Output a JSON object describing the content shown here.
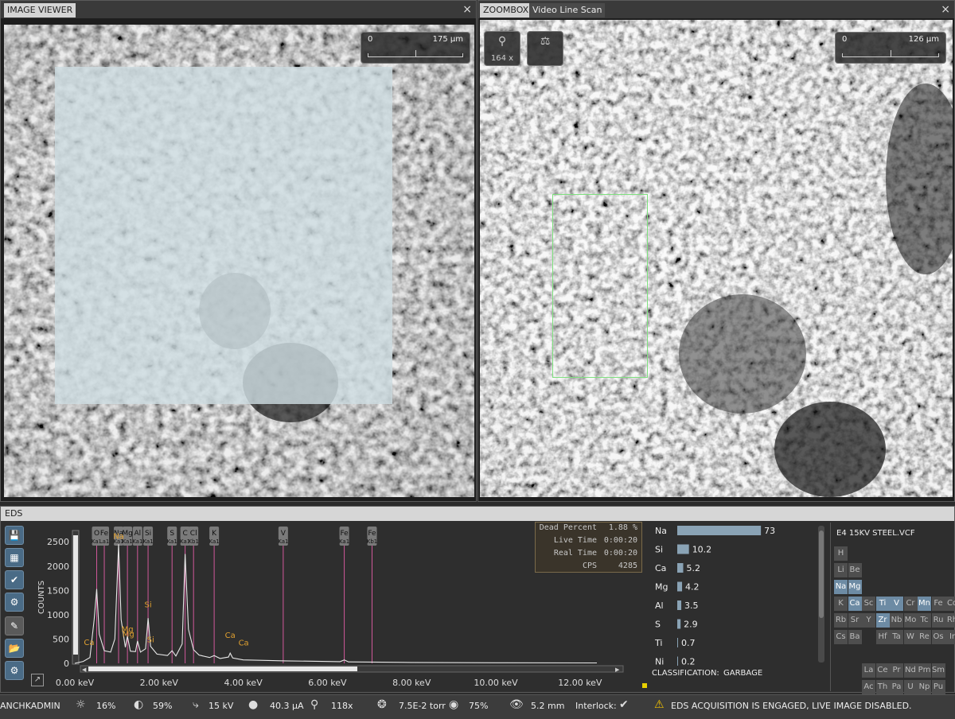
{
  "viewer": {
    "title": "IMAGE VIEWER",
    "close": "×",
    "scale_left": "0",
    "scale_right": "175 µm"
  },
  "zoombox": {
    "tabs": [
      "ZOOMBOX",
      "Video Line Scan"
    ],
    "close": "×",
    "zoom_label": "164 x",
    "zoom_icon": "search-icon",
    "flask_icon": "flask-icon",
    "scale_left": "0",
    "scale_right": "126 µm"
  },
  "eds": {
    "title": "EDS",
    "tools": [
      "save-icon",
      "table-icon",
      "check-icon",
      "gear-icon",
      "pencil-icon",
      "folder-icon",
      "gears-icon"
    ],
    "stats": {
      "rows": [
        {
          "label": "Dead Percent",
          "value": "1.88 %"
        },
        {
          "label": "Live Time",
          "value": "0:00:20"
        },
        {
          "label": "Real Time",
          "value": "0:00:20"
        },
        {
          "label": "CPS",
          "value": "4285"
        }
      ]
    },
    "classification_label": "CLASSIFICATION:",
    "classification_value": "GARBAGE",
    "vcf_name": "E4 15KV STEEL.VCF"
  },
  "chart_data": {
    "type": "line",
    "ylabel": "COUNTS",
    "ylim": [
      0,
      2700
    ],
    "xlim": [
      0,
      12.4
    ],
    "yticks": [
      "0",
      "500",
      "1000",
      "1500",
      "2000",
      "2500"
    ],
    "xticks": [
      "0.00 keV",
      "2.00 keV",
      "4.00 keV",
      "6.00 keV",
      "8.00 keV",
      "10.00 keV",
      "12.00 keV"
    ],
    "peak_markers": [
      {
        "name": "O",
        "line": "Ka1",
        "energy": 0.52
      },
      {
        "name": "Fe",
        "line": "La1",
        "energy": 0.7
      },
      {
        "name": "Na",
        "line": "Ka1",
        "energy": 1.04
      },
      {
        "name": "Mg",
        "line": "Ka1",
        "energy": 1.25
      },
      {
        "name": "Al",
        "line": "Ka1",
        "energy": 1.49
      },
      {
        "name": "Si",
        "line": "Ka1",
        "energy": 1.74
      },
      {
        "name": "S",
        "line": "Ka1",
        "energy": 2.31
      },
      {
        "name": "C",
        "line": "Ka1",
        "energy": 2.62
      },
      {
        "name": "Cl",
        "line": "Kb1",
        "energy": 2.82
      },
      {
        "name": "K",
        "line": "Ka1",
        "energy": 3.31
      },
      {
        "name": "V",
        "line": "Ka1",
        "energy": 4.95
      },
      {
        "name": "Fe",
        "line": "Ka1",
        "energy": 6.4
      },
      {
        "name": "Fe",
        "line": "Kb1",
        "energy": 7.06
      }
    ],
    "peak_labels": [
      {
        "text": "Ca",
        "energy": 0.34,
        "counts": 380
      },
      {
        "text": "Na",
        "energy": 1.04,
        "counts": 2560
      },
      {
        "text": "Mg",
        "energy": 1.25,
        "counts": 650
      },
      {
        "text": "Mg",
        "energy": 1.27,
        "counts": 550
      },
      {
        "text": "Si",
        "energy": 1.74,
        "counts": 1150
      },
      {
        "text": "Si",
        "energy": 1.8,
        "counts": 430
      },
      {
        "text": "Ca",
        "energy": 3.69,
        "counts": 520
      },
      {
        "text": "Ca",
        "energy": 4.01,
        "counts": 370
      }
    ],
    "spectrum": [
      [
        0.0,
        0
      ],
      [
        0.2,
        40
      ],
      [
        0.36,
        120
      ],
      [
        0.46,
        900
      ],
      [
        0.52,
        1530
      ],
      [
        0.58,
        600
      ],
      [
        0.7,
        260
      ],
      [
        0.85,
        230
      ],
      [
        0.95,
        500
      ],
      [
        1.04,
        2450
      ],
      [
        1.1,
        900
      ],
      [
        1.2,
        330
      ],
      [
        1.25,
        560
      ],
      [
        1.32,
        250
      ],
      [
        1.44,
        240
      ],
      [
        1.49,
        460
      ],
      [
        1.56,
        230
      ],
      [
        1.68,
        300
      ],
      [
        1.74,
        930
      ],
      [
        1.8,
        350
      ],
      [
        1.95,
        190
      ],
      [
        2.2,
        160
      ],
      [
        2.31,
        260
      ],
      [
        2.4,
        150
      ],
      [
        2.55,
        400
      ],
      [
        2.62,
        2250
      ],
      [
        2.7,
        700
      ],
      [
        2.82,
        280
      ],
      [
        2.95,
        170
      ],
      [
        3.2,
        120
      ],
      [
        3.31,
        160
      ],
      [
        3.45,
        100
      ],
      [
        3.65,
        130
      ],
      [
        3.69,
        210
      ],
      [
        3.75,
        110
      ],
      [
        4.0,
        70
      ],
      [
        5.0,
        50
      ],
      [
        6.3,
        35
      ],
      [
        6.4,
        70
      ],
      [
        6.5,
        30
      ],
      [
        8.0,
        18
      ],
      [
        10.0,
        12
      ],
      [
        12.4,
        8
      ]
    ]
  },
  "quant_data": {
    "type": "bar",
    "categories": [
      "Na",
      "Si",
      "Ca",
      "Mg",
      "Al",
      "S",
      "Ti",
      "Ni"
    ],
    "values": [
      73,
      10.2,
      5.2,
      4.2,
      3.5,
      2.9,
      0.7,
      0.2
    ],
    "value_labels": [
      "73",
      "10.2",
      "5.2",
      "4.2",
      "3.5",
      "2.9",
      "0.7",
      "0.2"
    ],
    "xlim": [
      0,
      75
    ]
  },
  "periodic_table": {
    "rows": [
      [
        {
          "s": "H"
        }
      ],
      [
        {
          "s": "Li"
        },
        {
          "s": "Be"
        }
      ],
      [
        {
          "s": "Na",
          "on": true
        },
        {
          "s": "Mg",
          "on": true
        }
      ],
      [
        {
          "s": "K"
        },
        {
          "s": "Ca",
          "on": true
        },
        {
          "s": "Sc"
        },
        {
          "s": "Ti",
          "on": true
        },
        {
          "s": "V",
          "on": true
        },
        {
          "s": "Cr"
        },
        {
          "s": "Mn",
          "on": true
        },
        {
          "s": "Fe"
        },
        {
          "s": "Co"
        }
      ],
      [
        {
          "s": "Rb"
        },
        {
          "s": "Sr"
        },
        {
          "s": "Y"
        },
        {
          "s": "Zr",
          "on": true
        },
        {
          "s": "Nb"
        },
        {
          "s": "Mo"
        },
        {
          "s": "Tc"
        },
        {
          "s": "Ru"
        },
        {
          "s": "Rh"
        }
      ],
      [
        {
          "s": "Cs"
        },
        {
          "s": "Ba"
        },
        {
          "s": ""
        },
        {
          "s": "Hf"
        },
        {
          "s": "Ta"
        },
        {
          "s": "W"
        },
        {
          "s": "Re"
        },
        {
          "s": "Os"
        },
        {
          "s": "Ir"
        }
      ],
      [
        {
          "s": ""
        }
      ],
      [
        {
          "s": ""
        },
        {
          "s": ""
        },
        {
          "s": "La"
        },
        {
          "s": "Ce"
        },
        {
          "s": "Pr"
        },
        {
          "s": "Nd"
        },
        {
          "s": "Pm"
        },
        {
          "s": "Sm"
        }
      ],
      [
        {
          "s": ""
        },
        {
          "s": ""
        },
        {
          "s": "Ac"
        },
        {
          "s": "Th"
        },
        {
          "s": "Pa"
        },
        {
          "s": "U"
        },
        {
          "s": "Np"
        },
        {
          "s": "Pu"
        }
      ]
    ]
  },
  "status": {
    "user": "ANCHKADMIN",
    "brightness": "16%",
    "contrast": "59%",
    "voltage": "15 kV",
    "current": "40.3 µA",
    "magnification": "118x",
    "pressure": "7.5E-2 torr",
    "spot": "75%",
    "working_distance": "5.2 mm",
    "interlock_label": "Interlock:",
    "warning": "EDS ACQUISITION IS ENGAGED, LIVE IMAGE DISABLED."
  }
}
